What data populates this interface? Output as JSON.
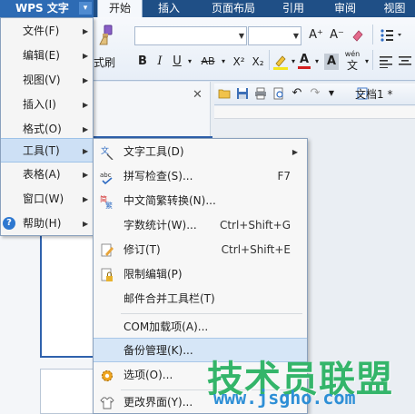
{
  "app": {
    "name": "WPS 文字",
    "arrow": "▾"
  },
  "ribbon_tabs": [
    "开始",
    "插入",
    "页面布局",
    "引用",
    "审阅",
    "视图"
  ],
  "ribbon": {
    "format_brush_label": "式刷",
    "bold": "B",
    "italic": "I",
    "underline": "U",
    "strike": "AB",
    "superscript": "X²",
    "subscript": "X₂",
    "grow_font": "A⁺",
    "shrink_font": "A⁻",
    "font_color": "A",
    "char_shade": "A",
    "phonetic_top": "wén",
    "phonetic_bottom": "文"
  },
  "quick_access": {
    "document_tab": "文档1 *"
  },
  "side_pane": {
    "close": "✕"
  },
  "main_menu": {
    "items": [
      {
        "label": "文件(F)"
      },
      {
        "label": "编辑(E)"
      },
      {
        "label": "视图(V)"
      },
      {
        "label": "插入(I)"
      },
      {
        "label": "格式(O)"
      },
      {
        "label": "工具(T)",
        "highlighted": true
      },
      {
        "label": "表格(A)"
      },
      {
        "label": "窗口(W)"
      },
      {
        "label": "帮助(H)",
        "icon": "help-icon"
      }
    ]
  },
  "tools_menu": {
    "items": [
      {
        "label": "文字工具(D)",
        "icon": "text-tools-icon",
        "submenu": true
      },
      {
        "label": "拼写检查(S)...",
        "icon": "spell-check-icon",
        "shortcut": "F7"
      },
      {
        "label": "中文简繁转换(N)...",
        "icon": "chinese-convert-icon"
      },
      {
        "label": "字数统计(W)...",
        "shortcut": "Ctrl+Shift+G"
      },
      {
        "label": "修订(T)",
        "icon": "revision-icon",
        "shortcut": "Ctrl+Shift+E"
      },
      {
        "label": "限制编辑(P)",
        "icon": "lock-icon"
      },
      {
        "label": "邮件合并工具栏(T)"
      },
      {
        "label": "COM加载项(A)..."
      },
      {
        "label": "备份管理(K)...",
        "highlighted": true
      },
      {
        "label": "选项(O)...",
        "icon": "gear-icon"
      },
      {
        "label": "更改界面(Y)...",
        "icon": "shirt-icon"
      }
    ]
  },
  "watermark": {
    "text": "技术员联盟",
    "url": "www.jsgho.com"
  },
  "colors": {
    "accent": "#2d6bb4",
    "highlight": "#d6e6f7",
    "watermark_green": "#34b56a",
    "watermark_blue": "#2e8fd6"
  }
}
